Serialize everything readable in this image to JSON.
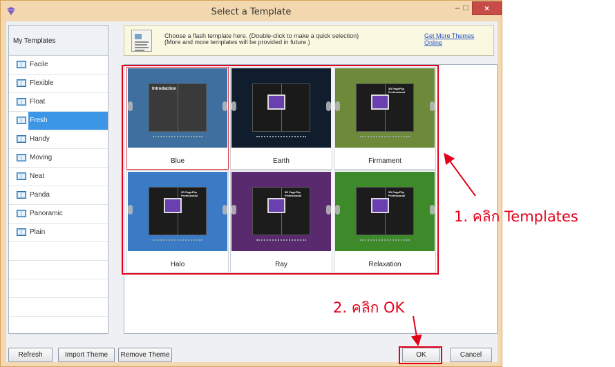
{
  "window": {
    "title": "Select a Template",
    "close_glyph": "×",
    "min_glyph": "–",
    "max_glyph": "□"
  },
  "sidebar": {
    "header": "My Templates",
    "items": [
      {
        "label": "Facile"
      },
      {
        "label": "Flexible"
      },
      {
        "label": "Float"
      },
      {
        "label": "Fresh"
      },
      {
        "label": "Handy"
      },
      {
        "label": "Moving"
      },
      {
        "label": "Neat"
      },
      {
        "label": "Panda"
      },
      {
        "label": "Panoramic"
      },
      {
        "label": "Plain"
      }
    ],
    "selected": "Fresh"
  },
  "info": {
    "line1": "Choose a flash template here. (Double-click to make a quick selection)",
    "line2": "(More and more templates will be provided in future.)",
    "link": "Get More Themes Online"
  },
  "templates": [
    {
      "name": "Blue",
      "bg": "#3f6f9e",
      "selected": true
    },
    {
      "name": "Earth",
      "bg": "#0f1d2c",
      "selected": false
    },
    {
      "name": "Firmament",
      "bg": "#6c8a3a",
      "selected": false
    },
    {
      "name": "Halo",
      "bg": "#3b7bc6",
      "selected": false
    },
    {
      "name": "Ray",
      "bg": "#5a2a6e",
      "selected": false
    },
    {
      "name": "Relaxation",
      "bg": "#3e8a2a",
      "selected": false
    }
  ],
  "thumb_titles": {
    "blue": "Introduction",
    "pro": "3D PageFlip Professional"
  },
  "buttons": {
    "refresh": "Refresh",
    "import": "Import Theme",
    "remove": "Remove Theme",
    "ok": "OK",
    "cancel": "Cancel"
  },
  "annotations": {
    "step1": "1. คลิก Templates",
    "step2": "2. คลิก OK"
  },
  "colors": {
    "annotation_red": "#e2001a",
    "selection_blue": "#3c96e6",
    "window_frame": "#f3d7ae"
  }
}
